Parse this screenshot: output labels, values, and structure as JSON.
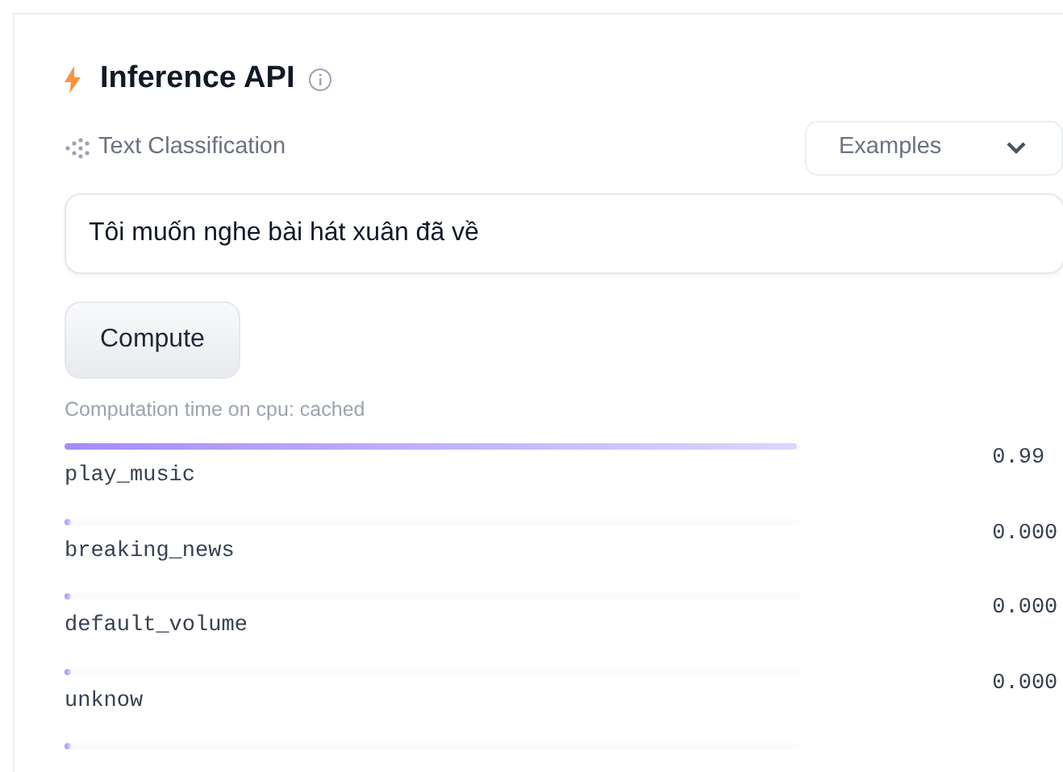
{
  "header": {
    "title": "Inference API"
  },
  "task": {
    "label": "Text Classification"
  },
  "examples": {
    "label": "Examples"
  },
  "input": {
    "value": "Tôi muốn nghe bài hát xuân đã về"
  },
  "compute_button": {
    "label": "Compute"
  },
  "computation_note": "Computation time on cpu: cached",
  "results": [
    {
      "label": "play_music",
      "level": 0.996,
      "score": "0.99"
    },
    {
      "label": "breaking_news",
      "level": 0.0,
      "score": "0.000"
    },
    {
      "label": "default_volume",
      "level": 0.0,
      "score": "0.000"
    },
    {
      "label": "unknow",
      "level": 0.0,
      "score": "0.000"
    },
    {
      "level": 0.0
    }
  ]
}
